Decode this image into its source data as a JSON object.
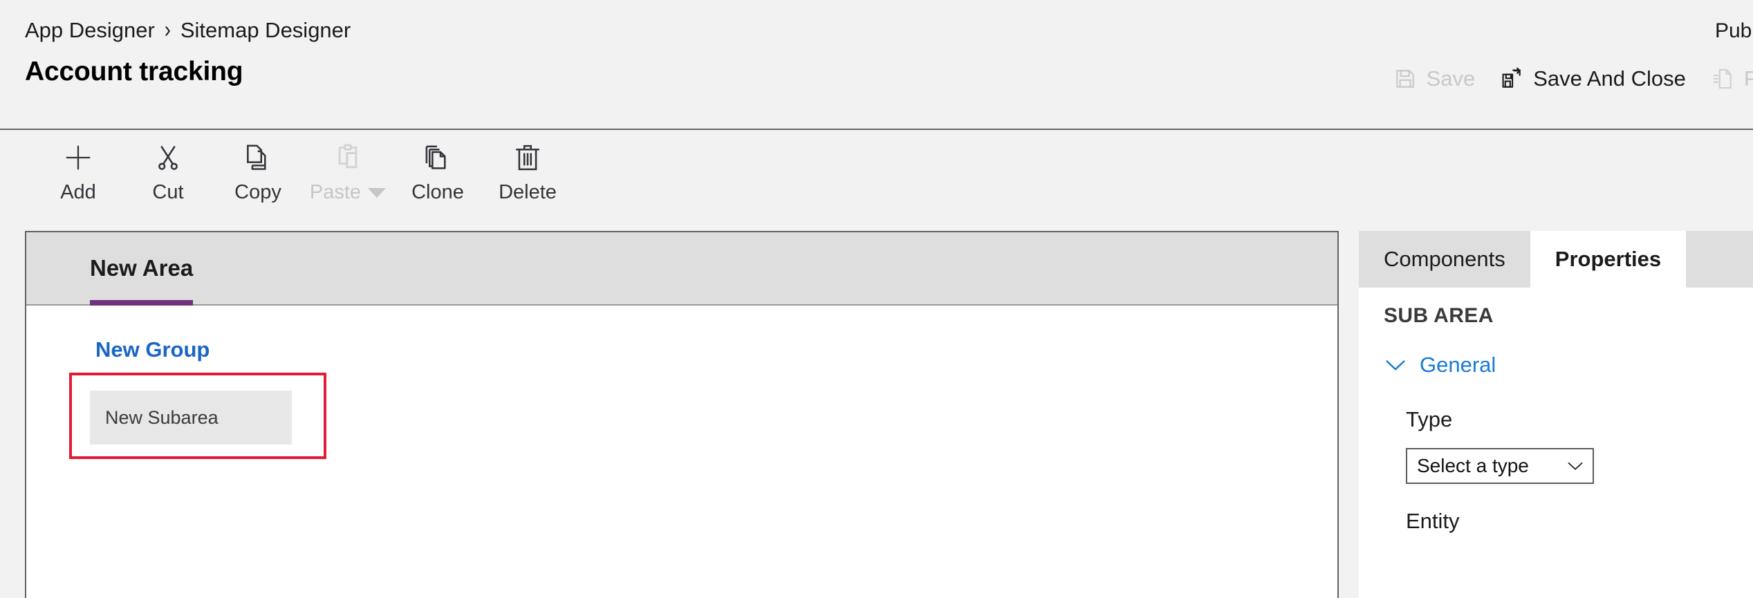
{
  "header": {
    "breadcrumb": {
      "root": "App Designer",
      "separator": "›",
      "current": "Sitemap Designer"
    },
    "title": "Account tracking",
    "status": "Publ",
    "actions": [
      {
        "label": "Save",
        "icon": "save-icon",
        "disabled": true
      },
      {
        "label": "Save And Close",
        "icon": "save-and-close-icon",
        "disabled": false
      },
      {
        "label": "Pub",
        "icon": "publish-icon",
        "disabled": true
      }
    ]
  },
  "commandbar": {
    "items": [
      {
        "label": "Add",
        "icon": "plus-icon",
        "disabled": false,
        "has_caret": false
      },
      {
        "label": "Cut",
        "icon": "scissors-icon",
        "disabled": false,
        "has_caret": false
      },
      {
        "label": "Copy",
        "icon": "copy-icon",
        "disabled": false,
        "has_caret": false
      },
      {
        "label": "Paste",
        "icon": "clipboard-icon",
        "disabled": true,
        "has_caret": true
      },
      {
        "label": "Clone",
        "icon": "clone-icon",
        "disabled": false,
        "has_caret": false
      },
      {
        "label": "Delete",
        "icon": "trash-icon",
        "disabled": false,
        "has_caret": false
      }
    ]
  },
  "canvas": {
    "area_tab": "New Area",
    "group_title": "New Group",
    "subarea_label": "New Subarea"
  },
  "panel": {
    "tabs": [
      {
        "label": "Components",
        "active": false
      },
      {
        "label": "Properties",
        "active": true
      }
    ],
    "heading": "SUB AREA",
    "section": {
      "label": "General",
      "expanded": true
    },
    "fields": [
      {
        "label": "Type",
        "control": "select",
        "value": "Select a type"
      },
      {
        "label": "Entity",
        "control": "none",
        "value": ""
      }
    ]
  },
  "colors": {
    "accent_purple": "#70317f",
    "link_blue": "#1966c5",
    "section_blue": "#1a7ad4",
    "selection_red": "#e01b33",
    "chrome_grey": "#f2f2f2",
    "tab_grey": "#dedede",
    "subarea_grey": "#e7e7e7",
    "disabled_grey": "#c6c6c6"
  }
}
